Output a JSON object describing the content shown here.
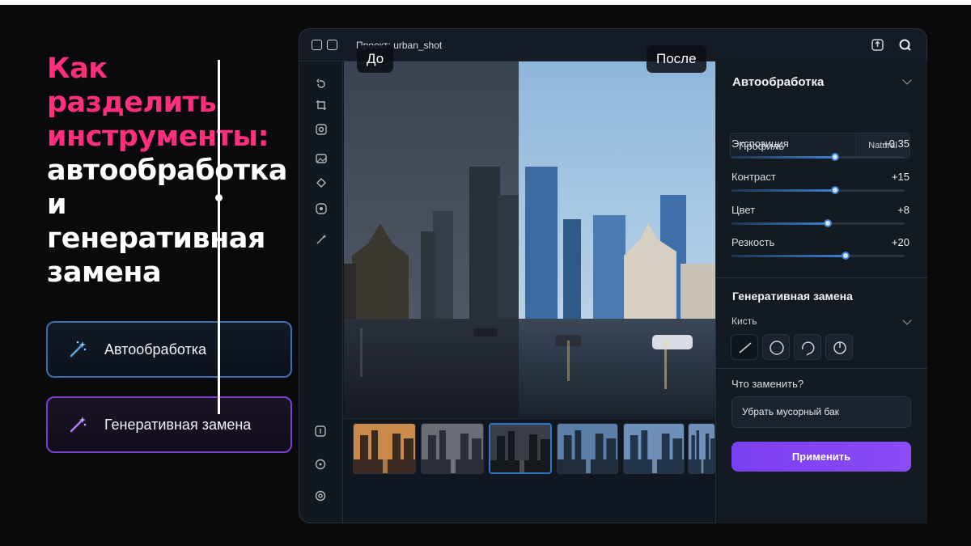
{
  "headline": {
    "pink": [
      "Как",
      "разделить",
      "инструменты:"
    ],
    "white": [
      "автообработка",
      "и генеративная",
      "замена"
    ]
  },
  "features": {
    "auto_label": "Автообработка",
    "gen_label": "Генеративная замена",
    "auto_icon": "magic-wand-icon",
    "gen_icon": "magic-wand-icon"
  },
  "app": {
    "title": "Проект: urban_shot",
    "before_label": "До",
    "after_label": "После",
    "comparison_position": 0.47,
    "filmstrip_selected": 2,
    "filmstrip_count": 6
  },
  "panel": {
    "auto_title": "Автообработка",
    "profile_label": "Профиль",
    "profile_value": "Natural",
    "sliders": [
      {
        "label": "Экспозиция",
        "value": "+0.35",
        "level": 0.58
      },
      {
        "label": "Контраст",
        "value": "+15",
        "level": 0.58
      },
      {
        "label": "Цвет",
        "value": "+8",
        "level": 0.54
      },
      {
        "label": "Резкость",
        "value": "+20",
        "level": 0.64
      }
    ],
    "gen_title": "Генеративная замена",
    "brush_label": "Кисть",
    "brushes": [
      "line-brush-icon",
      "circle-brush-icon",
      "lasso-brush-icon",
      "circle-select-icon"
    ],
    "question_label": "Что заменить?",
    "question_value": "Убрать мусорный бак",
    "apply_label": "Применить"
  },
  "colors": {
    "pink": "#ff2e7e",
    "accent_blue": "#3d7fd0",
    "accent_purple": "#8b4cf7"
  }
}
